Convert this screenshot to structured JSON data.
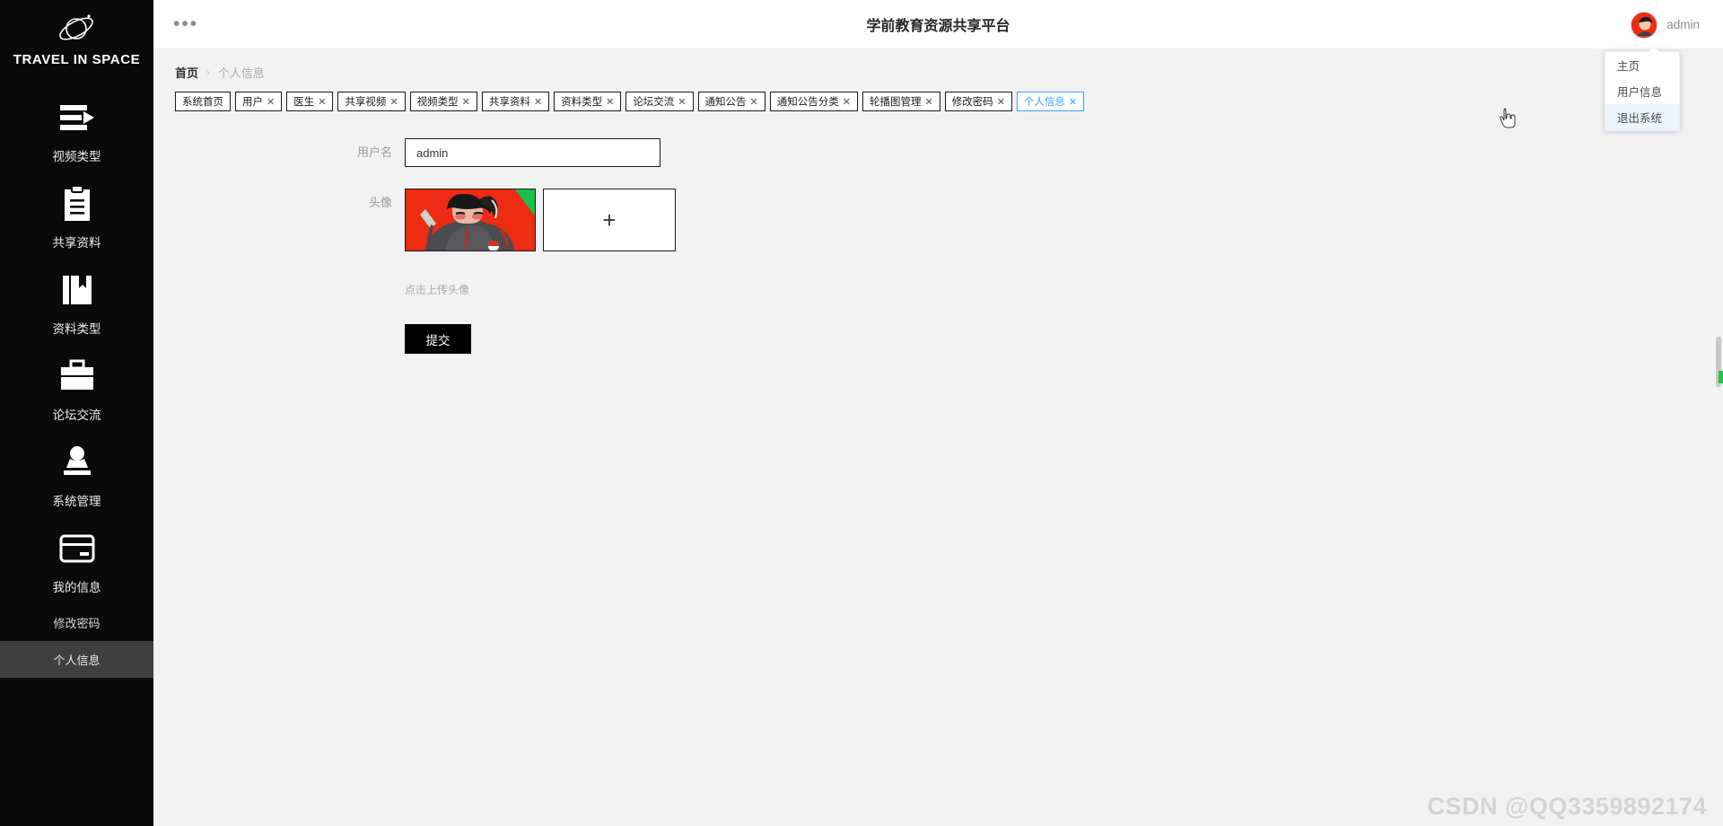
{
  "brand": {
    "name": "TRAVEL IN SPACE",
    "logo_icon": "planet-icon"
  },
  "sidebar": {
    "items": [
      {
        "label": "视频类型",
        "icon": "playlist-icon"
      },
      {
        "label": "共享资料",
        "icon": "clipboard-icon"
      },
      {
        "label": "资料类型",
        "icon": "books-icon"
      },
      {
        "label": "论坛交流",
        "icon": "briefcase-icon"
      },
      {
        "label": "系统管理",
        "icon": "stamp-icon"
      },
      {
        "label": "我的信息",
        "icon": "card-icon"
      }
    ],
    "sub_items": [
      {
        "label": "修改密码",
        "active": false
      },
      {
        "label": "个人信息",
        "active": true
      }
    ]
  },
  "header": {
    "menu_icon": "ellipsis-icon",
    "title": "学前教育资源共享平台",
    "user_name": "admin",
    "avatar_icon": "user-avatar"
  },
  "dropdown": {
    "items": [
      {
        "label": "主页",
        "highlighted": false
      },
      {
        "label": "用户信息",
        "highlighted": false
      },
      {
        "label": "退出系统",
        "highlighted": true
      }
    ]
  },
  "breadcrumb": {
    "home": "首页",
    "separator": "›",
    "current": "个人信息"
  },
  "tabs": [
    {
      "label": "系统首页",
      "closable": false,
      "active": false
    },
    {
      "label": "用户",
      "closable": true,
      "active": false
    },
    {
      "label": "医生",
      "closable": true,
      "active": false
    },
    {
      "label": "共享视频",
      "closable": true,
      "active": false
    },
    {
      "label": "视频类型",
      "closable": true,
      "active": false
    },
    {
      "label": "共享资料",
      "closable": true,
      "active": false
    },
    {
      "label": "资料类型",
      "closable": true,
      "active": false
    },
    {
      "label": "论坛交流",
      "closable": true,
      "active": false
    },
    {
      "label": "通知公告",
      "closable": true,
      "active": false
    },
    {
      "label": "通知公告分类",
      "closable": true,
      "active": false
    },
    {
      "label": "轮播图管理",
      "closable": true,
      "active": false
    },
    {
      "label": "修改密码",
      "closable": true,
      "active": false
    },
    {
      "label": "个人信息",
      "closable": true,
      "active": true
    }
  ],
  "form": {
    "username_label": "用户名",
    "username_value": "admin",
    "username_placeholder": "用户名",
    "avatar_label": "头像",
    "add_icon": "plus-icon",
    "upload_hint": "点击上传头像",
    "submit_label": "提交"
  },
  "watermark": "CSDN @QQ3359892174",
  "colors": {
    "sidebar_bg": "#0a0a0a",
    "accent": "#409eff",
    "content_bg": "#f2f2f2",
    "button_bg": "#000000",
    "avatar_red": "#ee2b13",
    "avatar_green": "#15c24a"
  }
}
